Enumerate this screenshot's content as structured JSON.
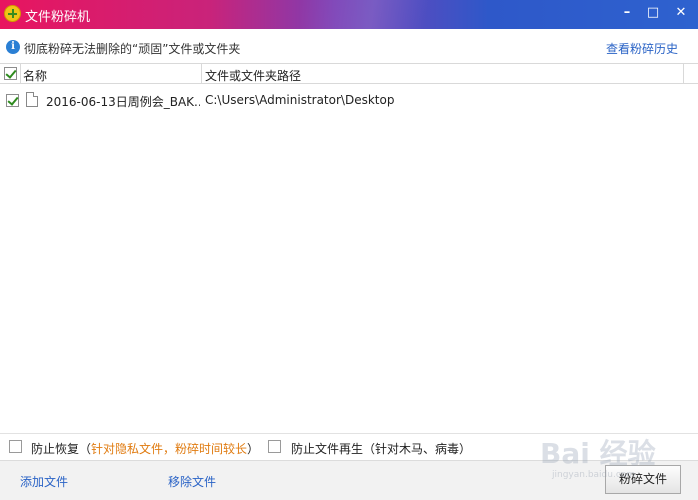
{
  "window": {
    "title": "文件粉碎机",
    "minimize": "–",
    "maximize": "□",
    "close": "✕"
  },
  "info": {
    "icon": "info-icon",
    "text": "彻底粉碎无法删除的“顽固”文件或文件夹",
    "history_link": "查看粉碎历史"
  },
  "table": {
    "headers": [
      "名称",
      "文件或文件夹路径"
    ],
    "rows": [
      {
        "checked": true,
        "name": "2016-06-13日周例会_BAK...",
        "path": "C:\\Users\\Administrator\\Desktop"
      }
    ]
  },
  "options": {
    "prevent_recovery_label": "防止恢复（",
    "prevent_recovery_note": "针对隐私文件，粉碎时间较长",
    "prevent_recovery_close": "）",
    "prevent_regen_label": "防止文件再生（针对木马、病毒）"
  },
  "bottom": {
    "add_file": "添加文件",
    "remove_file": "移除文件",
    "shred_button": "粉碎文件"
  },
  "watermark": {
    "text": "Bai 经验",
    "sub": "jingyan.baidu.com"
  },
  "colors": {
    "link": "#2a63c6",
    "accent_orange": "#e07b10",
    "check_green": "#2e8b1e"
  }
}
